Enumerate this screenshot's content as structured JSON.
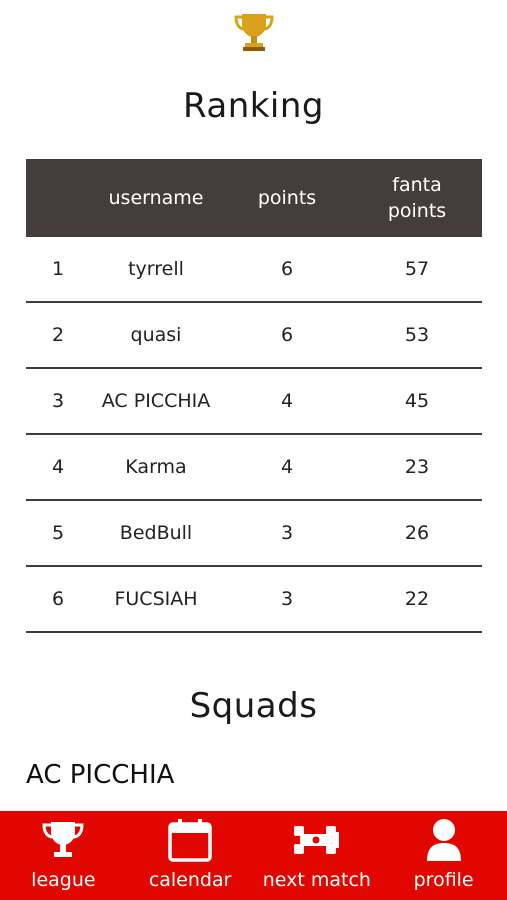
{
  "header": {
    "trophy_icon": "trophy-icon",
    "ranking_title": "Ranking"
  },
  "ranking": {
    "columns": [
      "",
      "username",
      "points",
      "fanta\npoints"
    ],
    "col_fanta_line1": "fanta",
    "col_fanta_line2": "points",
    "rows": [
      {
        "rank": "1",
        "username": "tyrrell",
        "points": "6",
        "fanta_points": "57"
      },
      {
        "rank": "2",
        "username": "quasi",
        "points": "6",
        "fanta_points": "53"
      },
      {
        "rank": "3",
        "username": "AC PICCHIA",
        "points": "4",
        "fanta_points": "45"
      },
      {
        "rank": "4",
        "username": "Karma",
        "points": "4",
        "fanta_points": "23"
      },
      {
        "rank": "5",
        "username": "BedBull",
        "points": "3",
        "fanta_points": "26"
      },
      {
        "rank": "6",
        "username": "FUCSIAH",
        "points": "3",
        "fanta_points": "22"
      }
    ]
  },
  "squads": {
    "title": "Squads",
    "first_squad": "AC PICCHIA"
  },
  "navbar": {
    "color": "#e10600",
    "items": [
      {
        "label": "league",
        "icon": "trophy-icon"
      },
      {
        "label": "calendar",
        "icon": "calendar-icon"
      },
      {
        "label": "next match",
        "icon": "race-car-icon"
      },
      {
        "label": "profile",
        "icon": "user-icon"
      }
    ]
  }
}
